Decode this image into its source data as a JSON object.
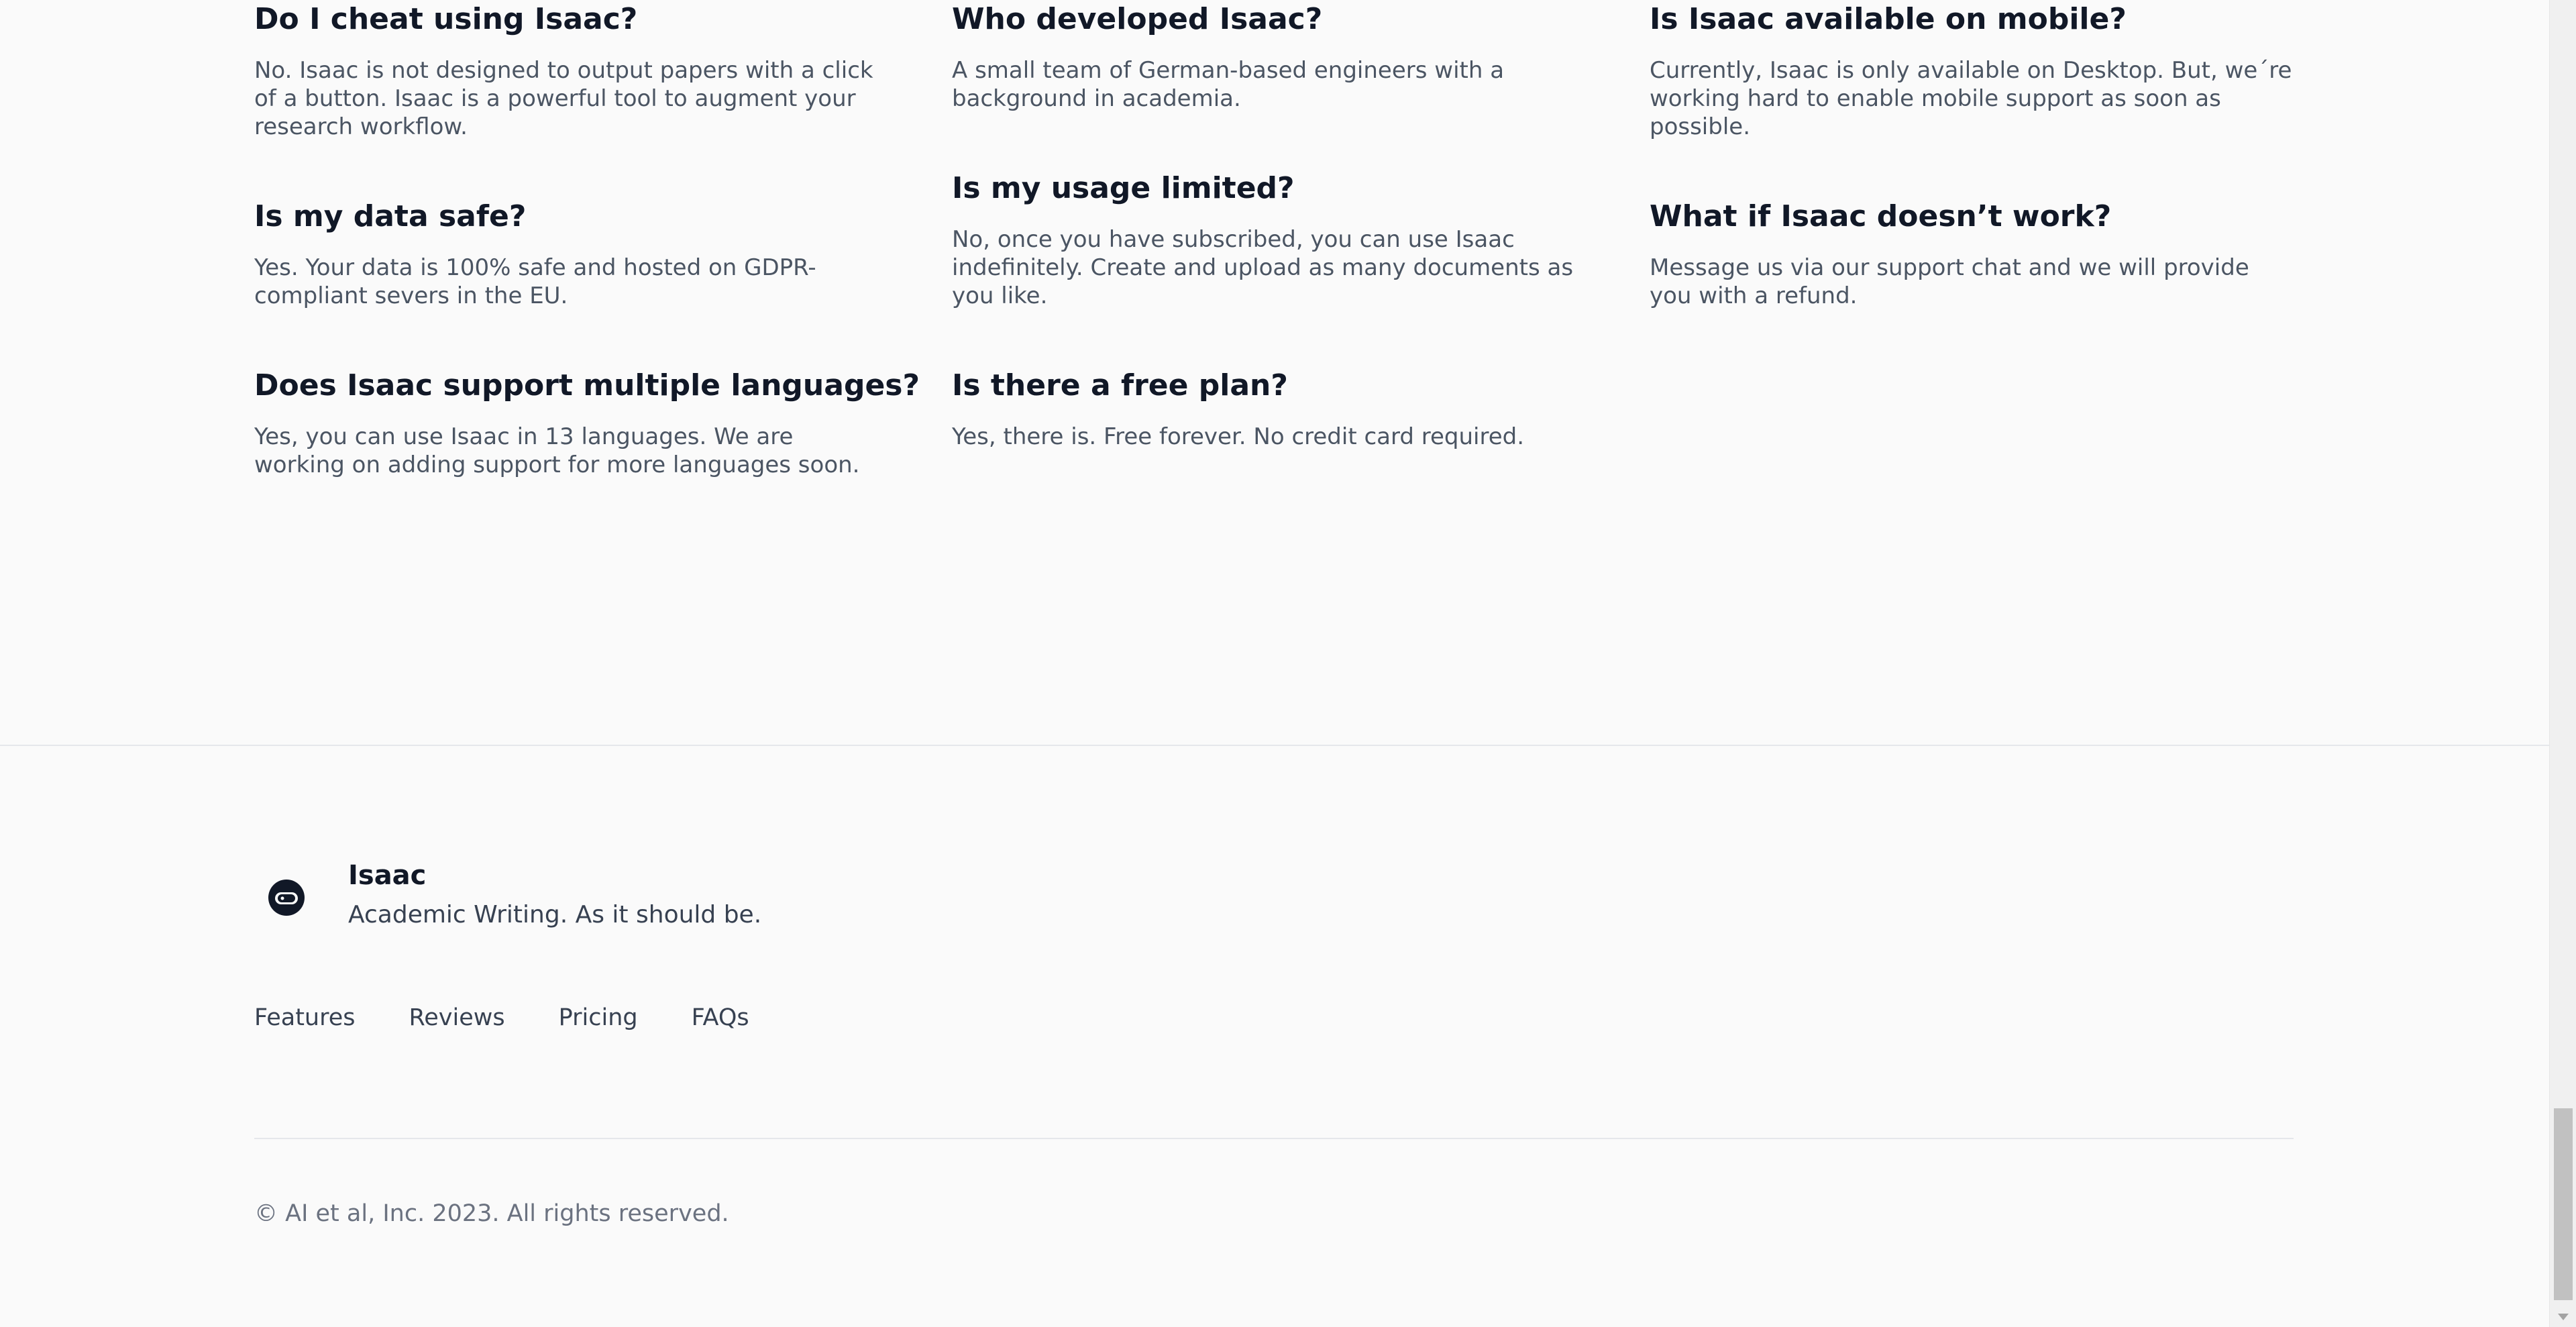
{
  "faq": {
    "col1": [
      {
        "q": "Do I cheat using Isaac?",
        "a": "No. Isaac is not designed to output papers with a click of a button. Isaac is a powerful tool to augment your research workflow."
      },
      {
        "q": "Is my data safe?",
        "a": "Yes. Your data is 100% safe and hosted on GDPR-compliant severs in the EU."
      },
      {
        "q": "Does Isaac support multiple languages?",
        "a": "Yes, you can use Isaac in 13 languages. We are working on adding support for more languages soon."
      }
    ],
    "col2": [
      {
        "q": "Who developed Isaac?",
        "a": "A small team of German-based engineers with a background in academia."
      },
      {
        "q": "Is my usage limited?",
        "a": "No, once you have subscribed, you can use Isaac indefinitely. Create and upload as many documents as you like."
      },
      {
        "q": "Is there a free plan?",
        "a": "Yes, there is. Free forever. No credit card required."
      }
    ],
    "col3": [
      {
        "q": "Is Isaac available on mobile?",
        "a": "Currently, Isaac is only available on Desktop. But, we´re working hard to enable mobile support as soon as possible."
      },
      {
        "q": "What if Isaac doesn’t work?",
        "a": "Message us via our support chat and we will provide you with a refund."
      }
    ]
  },
  "footer": {
    "brand_name": "Isaac",
    "tagline": "Academic Writing. As it should be.",
    "logo_icon": "astronaut-helmet-icon",
    "nav": [
      "Features",
      "Reviews",
      "Pricing",
      "FAQs"
    ],
    "copyright": "© AI et al, Inc. 2023. All rights reserved."
  }
}
